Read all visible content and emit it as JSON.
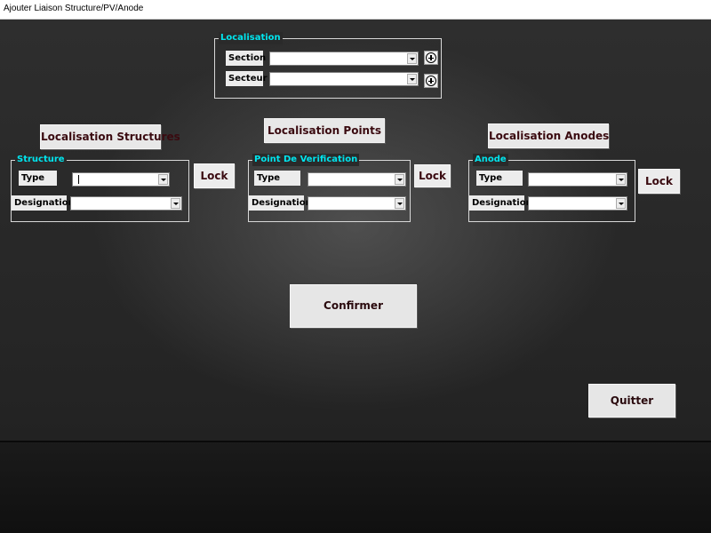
{
  "window": {
    "title": "Ajouter Liaison Structure/PV/Anode"
  },
  "localisation": {
    "legend": "Localisation",
    "section_label": "Section",
    "section_value": "",
    "secteur_label": "Secteur",
    "secteur_value": ""
  },
  "headers": {
    "structures": "Localisation Structures",
    "points": "Localisation Points",
    "anodes": "Localisation Anodes"
  },
  "structure": {
    "legend": "Structure",
    "type_label": "Type",
    "type_value": "",
    "designation_label": "Designation",
    "designation_value": ""
  },
  "point": {
    "legend": "Point De Verification",
    "type_label": "Type",
    "type_value": "",
    "designation_label": "Designation",
    "designation_value": ""
  },
  "anode": {
    "legend": "Anode",
    "type_label": "Type",
    "type_value": "",
    "designation_label": "Designation",
    "designation_value": ""
  },
  "buttons": {
    "lock": "Lock",
    "confirm": "Confirmer",
    "quit": "Quitter"
  },
  "colors": {
    "legend": "#00e5ee",
    "button_text": "#3a0a10",
    "background": "#2a2a2a"
  },
  "icons": {
    "add": "plus-circle-icon",
    "dropdown": "chevron-down-icon"
  }
}
